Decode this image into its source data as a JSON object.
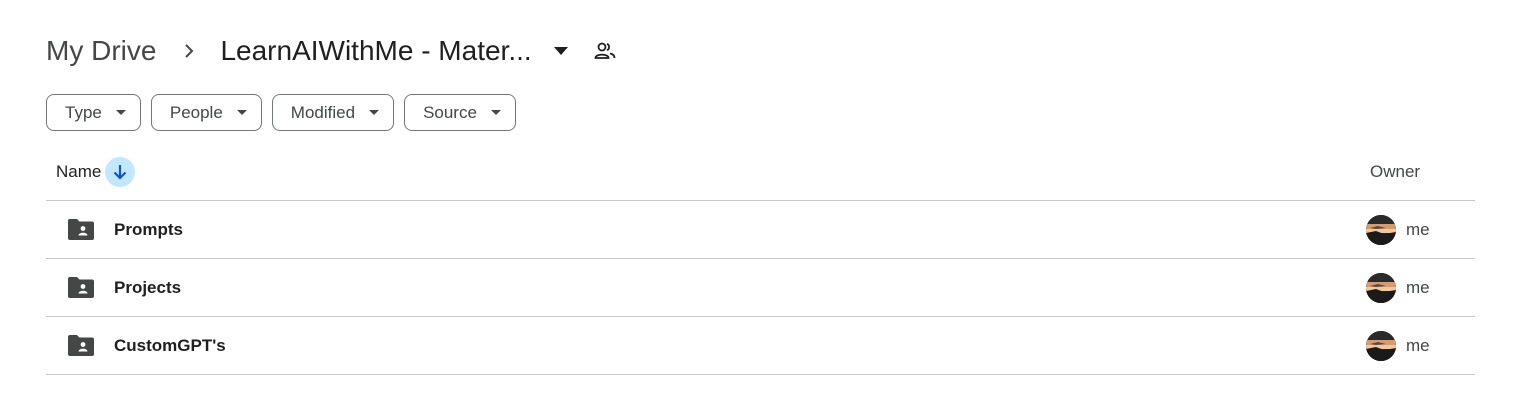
{
  "breadcrumb": {
    "root": "My Drive",
    "current": "LearnAIWithMe - Mater...",
    "separator_icon": "chevron-right-icon",
    "dropdown_icon": "caret-down-icon",
    "shared_icon": "people-icon"
  },
  "filters": [
    {
      "label": "Type",
      "icon": "caret-down-icon"
    },
    {
      "label": "People",
      "icon": "caret-down-icon"
    },
    {
      "label": "Modified",
      "icon": "caret-down-icon"
    },
    {
      "label": "Source",
      "icon": "caret-down-icon"
    }
  ],
  "table": {
    "columns": {
      "name": "Name",
      "owner": "Owner"
    },
    "sort_icon": "arrow-down-icon",
    "rows": [
      {
        "name": "Prompts",
        "owner": "me",
        "icon": "shared-folder-icon"
      },
      {
        "name": "Projects",
        "owner": "me",
        "icon": "shared-folder-icon"
      },
      {
        "name": "CustomGPT's",
        "owner": "me",
        "icon": "shared-folder-icon"
      }
    ]
  },
  "colors": {
    "sort_highlight": "#c2e7ff",
    "accent": "#0b57d0",
    "divider": "#c7c7c7",
    "chip_border": "#747775"
  }
}
